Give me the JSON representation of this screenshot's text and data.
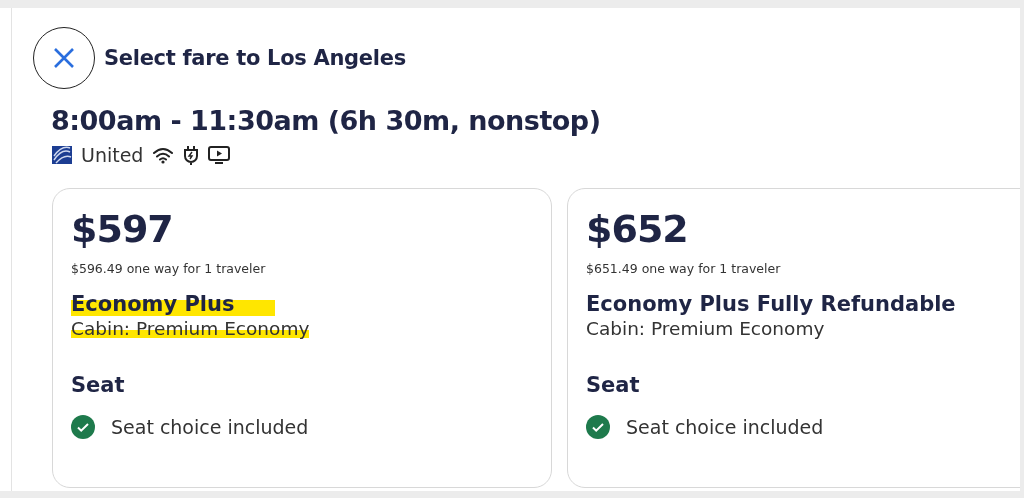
{
  "header": {
    "title": "Select fare to Los Angeles"
  },
  "flight": {
    "times": "8:00am - 11:30am (6h 30m, nonstop)",
    "airline": "United",
    "amenities": [
      {
        "kind": "wifi"
      },
      {
        "kind": "power"
      },
      {
        "kind": "entertainment"
      }
    ]
  },
  "fares": [
    {
      "price": "$597",
      "detail": "$596.49 one way for 1 traveler",
      "name": "Economy Plus",
      "cabin": "Cabin: Premium Economy",
      "highlighted": true,
      "section": "Seat",
      "features": [
        {
          "text": "Seat choice included",
          "included": true
        }
      ]
    },
    {
      "price": "$652",
      "detail": "$651.49 one way for 1 traveler",
      "name": "Economy Plus Fully Refundable",
      "cabin": "Cabin: Premium Economy",
      "highlighted": false,
      "section": "Seat",
      "features": [
        {
          "text": "Seat choice included",
          "included": true
        }
      ]
    }
  ]
}
